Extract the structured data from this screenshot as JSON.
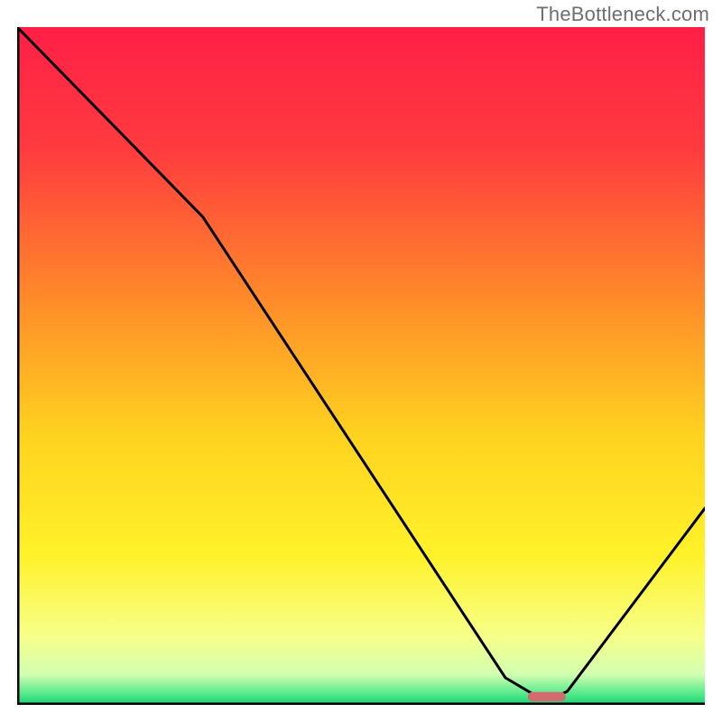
{
  "watermark": "TheBottleneck.com",
  "chart_data": {
    "type": "line",
    "title": "",
    "xlabel": "",
    "ylabel": "",
    "xlim": [
      0,
      100
    ],
    "ylim": [
      0,
      100
    ],
    "x": [
      0,
      27,
      71,
      76,
      78,
      80,
      100
    ],
    "values": [
      100,
      72,
      4,
      1,
      1,
      2,
      29
    ],
    "gradient_stops": [
      {
        "offset": 0.0,
        "color": "#ff1f47"
      },
      {
        "offset": 0.18,
        "color": "#ff3b3f"
      },
      {
        "offset": 0.4,
        "color": "#ff8a2a"
      },
      {
        "offset": 0.6,
        "color": "#ffd21f"
      },
      {
        "offset": 0.78,
        "color": "#fff22a"
      },
      {
        "offset": 0.9,
        "color": "#f6ff8a"
      },
      {
        "offset": 0.955,
        "color": "#d2ffb0"
      },
      {
        "offset": 0.985,
        "color": "#4fe88a"
      },
      {
        "offset": 1.0,
        "color": "#18d170"
      }
    ],
    "marker": {
      "x_norm": 0.77,
      "y_norm": 0.012,
      "width_norm": 0.055,
      "height_norm": 0.014,
      "fill": "#d36a6f"
    },
    "axes": {
      "stroke": "#000000",
      "width": 3
    }
  }
}
